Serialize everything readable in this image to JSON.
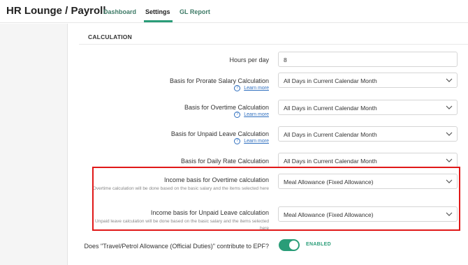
{
  "app": {
    "title": "HR Lounge  /  Payroll"
  },
  "nav": {
    "tabs": [
      {
        "label": "Dashboard"
      },
      {
        "label": "Settings"
      },
      {
        "label": "GL Report"
      }
    ],
    "active_tab": "Settings"
  },
  "section": {
    "title": "CALCULATION"
  },
  "fields": [
    {
      "label": "Hours per day",
      "value": "8"
    },
    {
      "label": "Basis for Prorate Salary Calculation",
      "help": "Learn more",
      "value": "All Days in Current Calendar Month"
    },
    {
      "label": "Basis for Overtime Calculation",
      "help": "Learn more",
      "value": "All Days in Current Calendar Month"
    },
    {
      "label": "Basis for Unpaid Leave Calculation",
      "help": "Learn more",
      "value": "All Days in Current Calendar Month"
    },
    {
      "label": "Basis for Daily Rate Calculation",
      "value": "All Days in Current Calendar Month"
    },
    {
      "label": "Income basis for Overtime calculation",
      "description": "Overtime calculation will be done based on the basic salary and the items selected here",
      "value": "Meal Allowance (Fixed Allowance)"
    },
    {
      "label": "Income basis for Unpaid Leave calculation",
      "description": "Unpaid leave calculation will be done based on the basic salary and the items selected here",
      "value": "Meal Allowance (Fixed Allowance)"
    }
  ],
  "epf_toggle": {
    "label": "Does \"Travel/Petrol Allowance (Official Duties)\" contribute to EPF?",
    "status": "ENABLED",
    "enabled": true
  },
  "colors": {
    "accent": "#2a9d78",
    "highlight": "#e01818",
    "link": "#2f6fbf"
  },
  "icons": {
    "help": "question-circle-icon",
    "dropdown": "chevron-down-icon"
  }
}
